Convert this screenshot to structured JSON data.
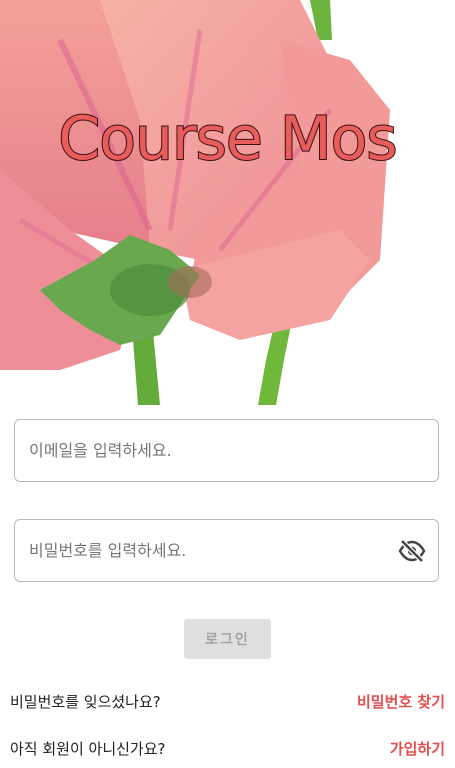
{
  "app": {
    "title": "Course Mos"
  },
  "login": {
    "email_placeholder": "이메일을 입력하세요.",
    "password_placeholder": "비밀번호를 입력하세요.",
    "login_label": "로그인"
  },
  "links": {
    "forgot_question": "비밀번호를 잊으셨나요?",
    "forgot_action": "비밀번호 찾기",
    "signup_question": "아직 회원이 아니신가요?",
    "signup_action": "가입하기"
  },
  "icons": {
    "password_toggle": "eye-off-icon"
  },
  "colors": {
    "accent": "#e24f4f",
    "title": "#e85c5c",
    "disabled_button": "#e0e0e0"
  }
}
